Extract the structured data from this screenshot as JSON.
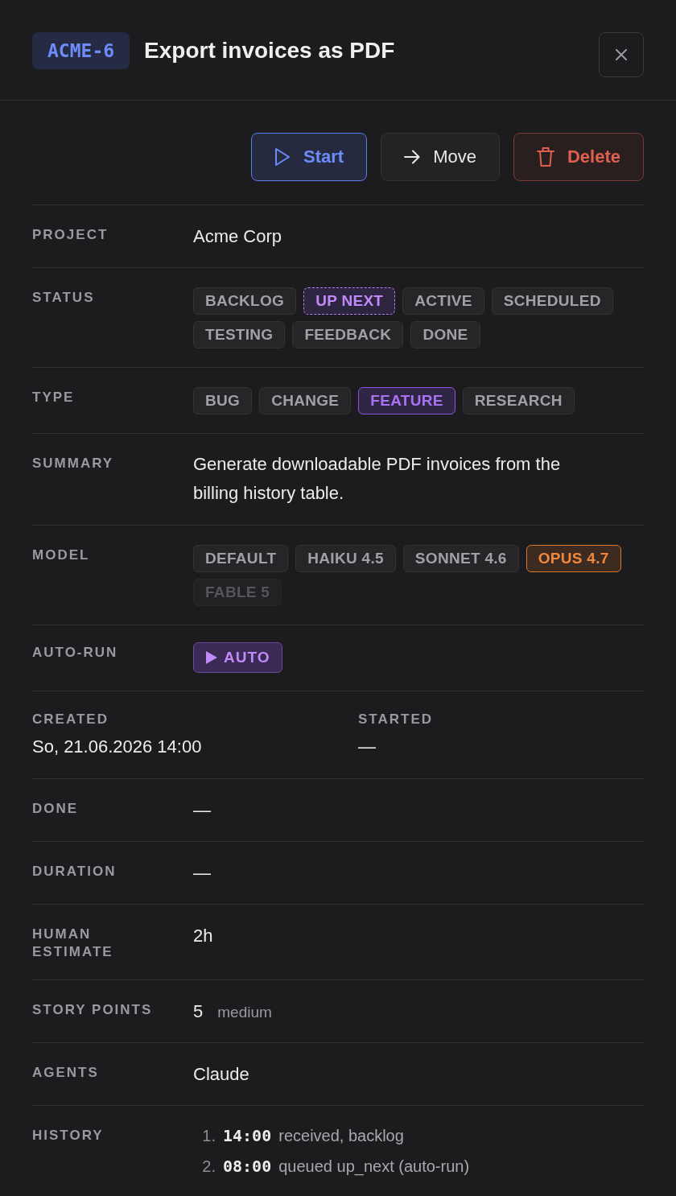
{
  "header": {
    "key": "ACME-6",
    "title": "Export invoices as PDF"
  },
  "actions": [
    {
      "kind": "start",
      "label": "Start"
    },
    {
      "kind": "move",
      "label": "Move"
    },
    {
      "kind": "delete",
      "label": "Delete"
    }
  ],
  "fields": [
    {
      "kind": "text",
      "label": "PROJECT",
      "value": "Acme Corp"
    },
    {
      "kind": "status",
      "label": "STATUS",
      "chips": [
        {
          "label": "BACKLOG",
          "selected": false
        },
        {
          "label": "UP NEXT",
          "selected": true
        },
        {
          "label": "ACTIVE",
          "selected": false
        },
        {
          "label": "SCHEDULED",
          "selected": false
        },
        {
          "label": "TESTING",
          "selected": false
        },
        {
          "label": "FEEDBACK",
          "selected": false
        },
        {
          "label": "DONE",
          "selected": false
        }
      ]
    },
    {
      "kind": "type",
      "label": "TYPE",
      "chips": [
        {
          "label": "BUG",
          "selected": false
        },
        {
          "label": "CHANGE",
          "selected": false
        },
        {
          "label": "FEATURE",
          "selected": true
        },
        {
          "label": "RESEARCH",
          "selected": false
        }
      ]
    },
    {
      "kind": "summary",
      "label": "SUMMARY",
      "value": "Generate downloadable PDF invoices from the billing history table."
    },
    {
      "kind": "model",
      "label": "MODEL",
      "chips": [
        {
          "label": "DEFAULT",
          "selected": false,
          "disabled": false
        },
        {
          "label": "HAIKU 4.5",
          "selected": false,
          "disabled": false
        },
        {
          "label": "SONNET 4.6",
          "selected": false,
          "disabled": false
        },
        {
          "label": "OPUS 4.7",
          "selected": true,
          "disabled": false
        },
        {
          "label": "FABLE 5",
          "selected": false,
          "disabled": true
        }
      ]
    },
    {
      "kind": "toggle",
      "label": "AUTO-RUN",
      "toggle": {
        "label": "AUTO",
        "on": true
      }
    },
    {
      "kind": "pair",
      "columns": [
        {
          "label": "CREATED",
          "value": "So, 21.06.2026 14:00"
        },
        {
          "label": "STARTED",
          "value": "—"
        }
      ]
    },
    {
      "kind": "text",
      "label": "DONE",
      "value": "—"
    },
    {
      "kind": "text",
      "label": "DURATION",
      "value": "—"
    },
    {
      "kind": "text",
      "label": "HUMAN ESTIMATE",
      "value": "2h"
    },
    {
      "kind": "points",
      "label": "STORY POINTS",
      "value": "5",
      "note": "medium"
    },
    {
      "kind": "text",
      "label": "AGENTS",
      "value": "Claude"
    },
    {
      "kind": "history",
      "label": "HISTORY",
      "entries": [
        {
          "number": "1.",
          "time": "14:00",
          "text": "received, backlog"
        },
        {
          "number": "2.",
          "time": "08:00",
          "text": "queued up_next (auto-run)"
        }
      ]
    }
  ]
}
